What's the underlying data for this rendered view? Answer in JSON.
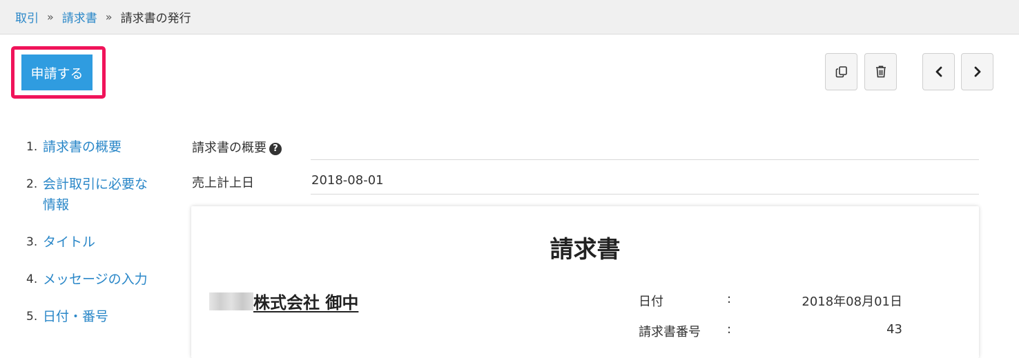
{
  "breadcrumb": {
    "items": [
      "取引",
      "請求書"
    ],
    "separator": "»",
    "current": "請求書の発行"
  },
  "toolbar": {
    "apply_label": "申請する",
    "copy_icon": "copy-icon",
    "delete_icon": "trash-icon",
    "prev_icon": "chevron-left-icon",
    "next_icon": "chevron-right-icon"
  },
  "toc": {
    "items": [
      {
        "num": "1.",
        "label": "請求書の概要"
      },
      {
        "num": "2.",
        "label": "会計取引に必要な情報"
      },
      {
        "num": "3.",
        "label": "タイトル"
      },
      {
        "num": "4.",
        "label": "メッセージの入力"
      },
      {
        "num": "5.",
        "label": "日付・番号"
      }
    ]
  },
  "overview": {
    "section_label": "請求書の概要",
    "help_icon": "question-circle-icon",
    "sales_date_label": "売上計上日",
    "sales_date_value": "2018-08-01"
  },
  "invoice": {
    "title": "請求書",
    "recipient": "株式会社 御中",
    "date_label": "日付",
    "date_value": "2018年08月01日",
    "number_label": "請求書番号",
    "number_value": "43",
    "colon": ":"
  },
  "colors": {
    "accent": "#2f9ce0",
    "link": "#2a87c8",
    "highlight": "#f0145a"
  }
}
